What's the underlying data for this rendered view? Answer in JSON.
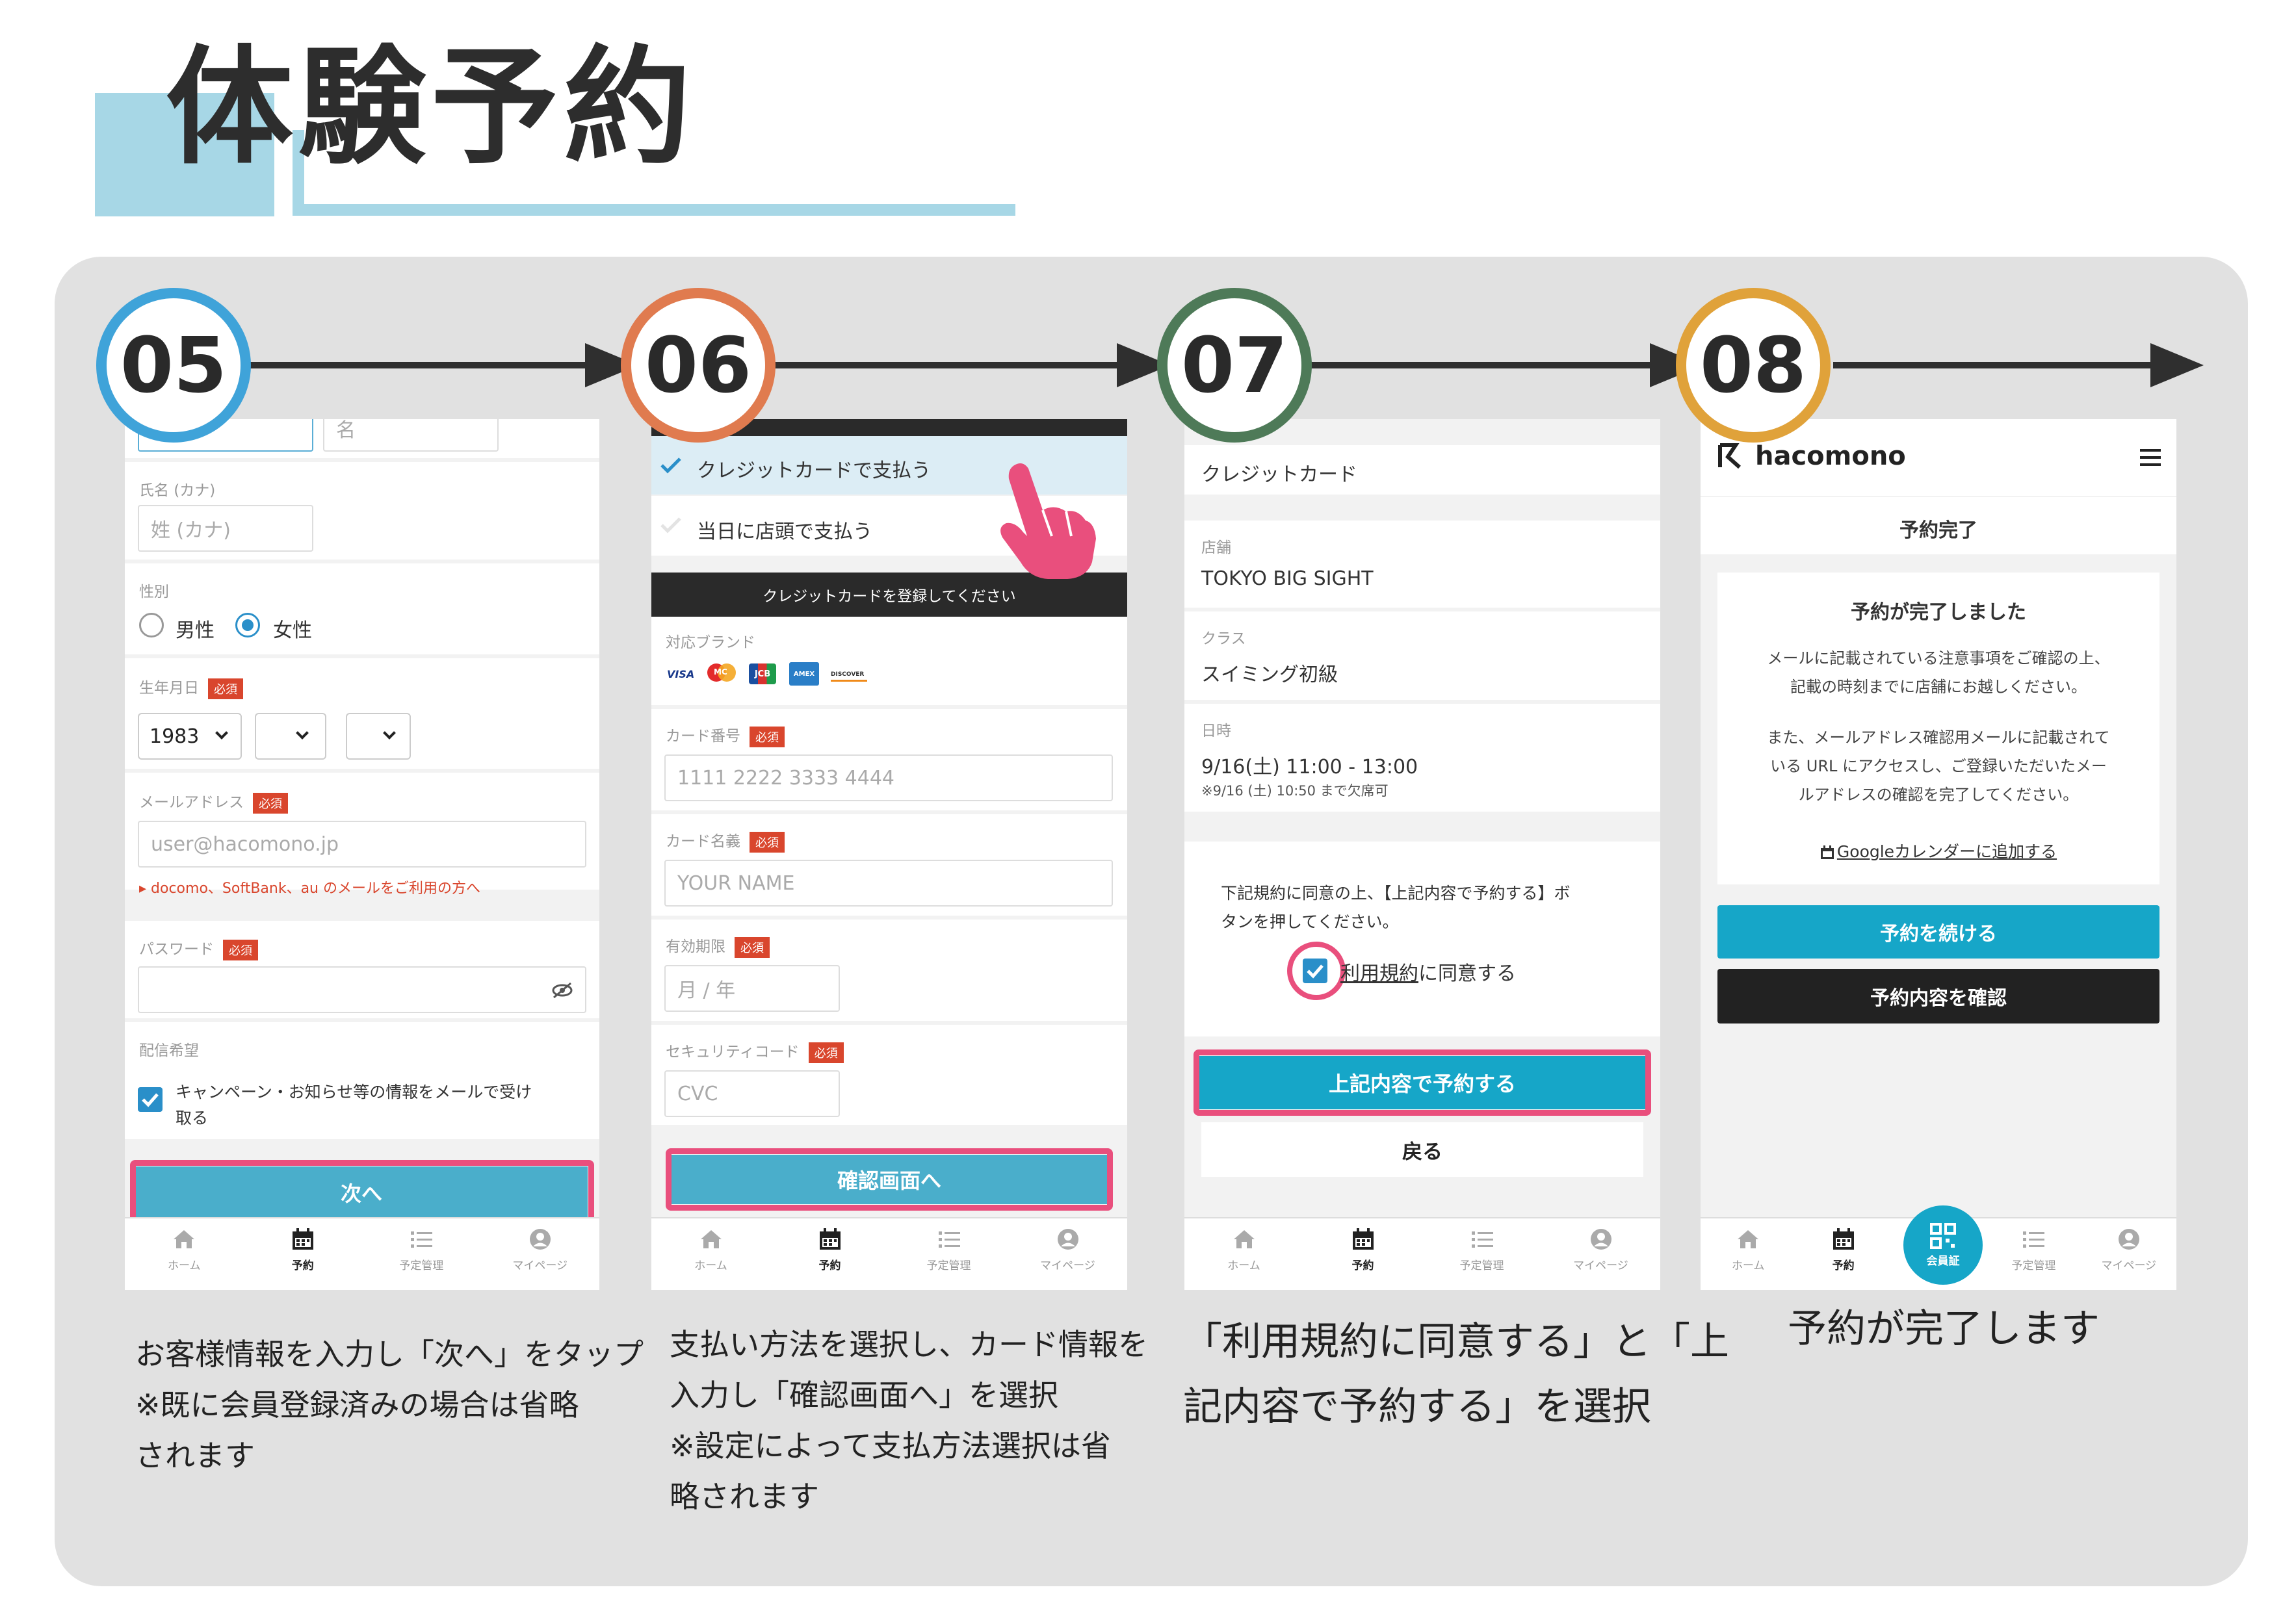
{
  "title": "体験予約",
  "colors": {
    "accent_light": "#a7d7e6",
    "step05": "#3fa3d9",
    "step06": "#e07b4f",
    "step07": "#4e7a58",
    "step08": "#e0a23a",
    "highlight": "#e94f7d",
    "primary_button": "#16a6c8",
    "dark_button": "#222222",
    "required_badge": "#d9462d"
  },
  "steps": [
    {
      "num": "05",
      "caption": [
        "お客様情報を入力し「次へ」をタップ",
        "※既に会員登録済みの場合は省略",
        "されます"
      ]
    },
    {
      "num": "06",
      "caption": [
        "支払い方法を選択し、カード情報を",
        "入力し「確認画面へ」を選択",
        "※設定によって支払方法選択は省",
        "略されます"
      ]
    },
    {
      "num": "07",
      "caption": [
        "「利用規約に同意する」と「上",
        "記内容で予約する」を選択"
      ]
    },
    {
      "num": "08",
      "caption": [
        "予約が完了します"
      ]
    }
  ],
  "nav": {
    "home": "ホーム",
    "reserve": "予約",
    "schedule": "予定管理",
    "mypage": "マイページ",
    "member_card": "会員証"
  },
  "screen05": {
    "first_name_placeholder": "名",
    "kana_label": "氏名 (カナ)",
    "kana_placeholder": "姓 (カナ)",
    "gender_label": "性別",
    "gender_male": "男性",
    "gender_female": "女性",
    "birth_label": "生年月日",
    "required": "必須",
    "birth_year": "1983",
    "email_label": "メールアドレス",
    "email_placeholder": "user@hacomono.jp",
    "email_note": "▸ docomo、SoftBank、au のメールをご利用の方へ",
    "password_label": "パスワード",
    "newsletter_label": "配信希望",
    "newsletter_text_1": "キャンペーン・お知らせ等の情報をメールで受け",
    "newsletter_text_2": "取る",
    "next_button": "次へ"
  },
  "screen06": {
    "pay_credit": "クレジットカードで支払う",
    "pay_store": "当日に店頭で支払う",
    "register_header": "クレジットカードを登録してください",
    "brands_label": "対応ブランド",
    "brands": [
      "VISA",
      "MC",
      "JCB",
      "AMEX",
      "DISCOVER"
    ],
    "card_number_label": "カード番号",
    "card_number_placeholder": "1111 2222 3333 4444",
    "card_name_label": "カード名義",
    "card_name_placeholder": "YOUR NAME",
    "expiry_label": "有効期限",
    "expiry_placeholder": "月 / 年",
    "cvc_label": "セキュリティコード",
    "cvc_placeholder": "CVC",
    "required": "必須",
    "confirm_button": "確認画面へ"
  },
  "screen07": {
    "payment_value": "クレジットカード",
    "store_label": "店舗",
    "store_value": "TOKYO BIG SIGHT",
    "class_label": "クラス",
    "class_value": "スイミング初級",
    "datetime_label": "日時",
    "datetime_value": "9/16(土) 11:00 - 13:00",
    "cancel_note": "※9/16 (土) 10:50 まで欠席可",
    "agree_text_1": "下記規約に同意の上、【上記内容で予約する】ボ",
    "agree_text_2": "タンを押してください。",
    "terms_link": "利用規約",
    "terms_suffix": "に同意する",
    "reserve_button": "上記内容で予約する",
    "back_button": "戻る"
  },
  "screen08": {
    "brand": "hacomono",
    "page_title": "予約完了",
    "complete_heading": "予約が完了しました",
    "msg_1": "メールに記載されている注意事項をご確認の上、",
    "msg_2": "記載の時刻までに店舗にお越しください。",
    "msg_3": "また、メールアドレス確認用メールに記載されて",
    "msg_4": "いる URL にアクセスし、ご登録いただいたメー",
    "msg_5": "ルアドレスの確認を完了してください。",
    "calendar_link": "Googleカレンダーに追加する",
    "continue_button": "予約を続ける",
    "check_button": "予約内容を確認"
  }
}
